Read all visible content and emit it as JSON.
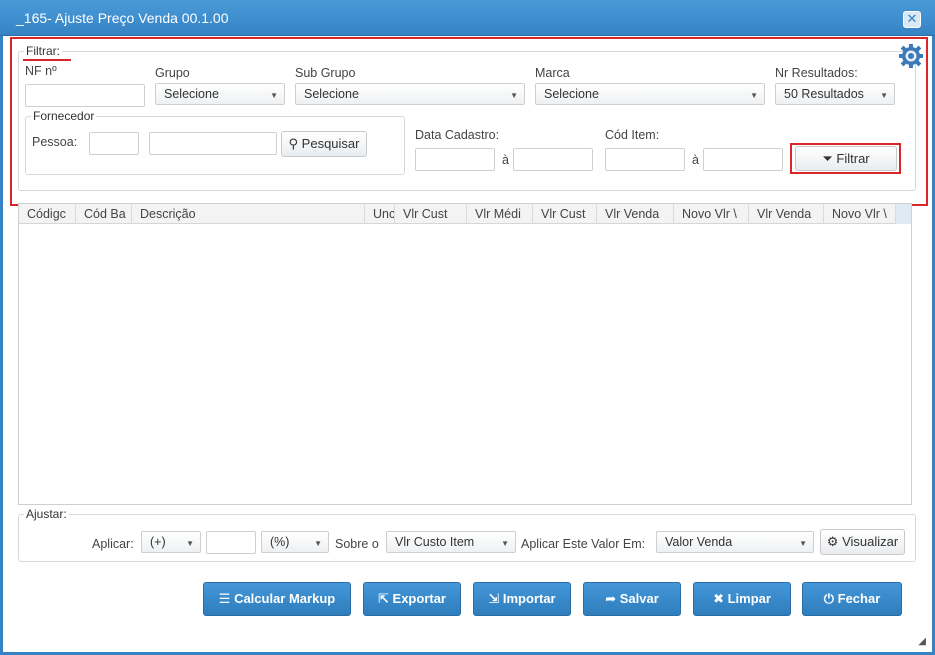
{
  "window": {
    "title": "_165- Ajuste Preço Venda 00.1.00",
    "close_label": "✕"
  },
  "filter": {
    "legend": "Filtrar:",
    "nf_label": "NF nº",
    "grupo_label": "Grupo",
    "grupo_value": "Selecione",
    "subgrupo_label": "Sub Grupo",
    "subgrupo_value": "Selecione",
    "marca_label": "Marca",
    "marca_value": "Selecione",
    "nr_label": "Nr Resultados:",
    "nr_value": "50 Resultados",
    "fornecedor_legend": "Fornecedor",
    "pessoa_label": "Pessoa:",
    "pesquisar_label": "Pesquisar",
    "data_label": "Data Cadastro:",
    "a_sep": "à",
    "cod_item_label": "Cód Item:",
    "filtrar_button": "Filtrar"
  },
  "grid": {
    "columns": [
      "Códigc",
      "Cód Ba",
      "Descrição",
      "Unc",
      "Vlr Cust",
      "Vlr Médi",
      "Vlr Cust",
      "Vlr Venda",
      "Novo Vlr \\",
      "Vlr Venda",
      "Novo Vlr \\"
    ]
  },
  "ajustar": {
    "legend": "Ajustar:",
    "aplicar_label": "Aplicar:",
    "sign_value": "(+)",
    "pct_value": "(%)",
    "sobre_label": "Sobre o",
    "sobre_value": "Vlr Custo Item",
    "aplicar_em_label": "Aplicar Este Valor Em:",
    "aplicar_em_value": "Valor Venda",
    "visualizar_label": "Visualizar"
  },
  "actions": {
    "calcular": "Calcular Markup",
    "exportar": "Exportar",
    "importar": "Importar",
    "salvar": "Salvar",
    "limpar": "Limpar",
    "fechar": "Fechar"
  },
  "colors": {
    "accent": "#3583c4",
    "highlight": "#d9262a"
  }
}
